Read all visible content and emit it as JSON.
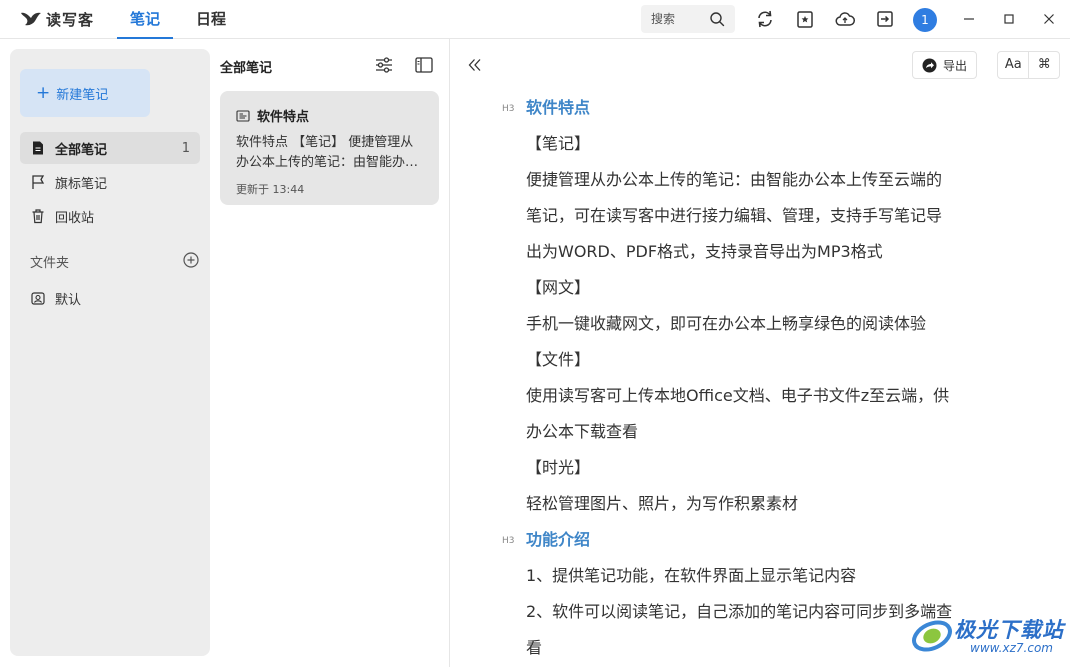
{
  "app": {
    "name": "读写客"
  },
  "top_tabs": [
    {
      "label": "笔记",
      "active": true
    },
    {
      "label": "日程",
      "active": false
    }
  ],
  "search": {
    "placeholder": "搜索"
  },
  "user": {
    "badge": "1"
  },
  "colors": {
    "accent": "#2478d8",
    "heading": "#3f86c8",
    "sidebar_bg": "#ededed",
    "new_note_bg": "#d6e4f5"
  },
  "sidebar": {
    "new_note_label": "新建笔记",
    "items": [
      {
        "label": "全部笔记",
        "count": "1",
        "icon": "note-icon",
        "active": true
      },
      {
        "label": "旗标笔记",
        "icon": "flag-icon"
      },
      {
        "label": "回收站",
        "icon": "trash-icon"
      }
    ],
    "folders_label": "文件夹",
    "folders": [
      {
        "label": "默认",
        "icon": "folder-user-icon"
      }
    ]
  },
  "note_list": {
    "title": "全部笔记",
    "notes": [
      {
        "title": "软件特点",
        "excerpt": "软件特点 【笔记】 便捷管理从办公本上传的笔记：由智能办公本上传至云端的笔记",
        "updated": "更新于 13:44"
      }
    ]
  },
  "editor": {
    "export_label": "导出",
    "font_button": "Aa",
    "shortcut_button": "⌘",
    "lines": [
      {
        "type": "h3",
        "tag": "H3",
        "text": "软件特点"
      },
      {
        "type": "p",
        "text": "【笔记】"
      },
      {
        "type": "p",
        "text": "便捷管理从办公本上传的笔记：由智能办公本上传至云端的"
      },
      {
        "type": "p",
        "text": "笔记，可在读写客中进行接力编辑、管理，支持手写笔记导"
      },
      {
        "type": "p",
        "text": "出为WORD、PDF格式，支持录音导出为MP3格式"
      },
      {
        "type": "p",
        "text": "【网文】"
      },
      {
        "type": "p",
        "text": "手机一键收藏网文，即可在办公本上畅享绿色的阅读体验"
      },
      {
        "type": "p",
        "text": "【文件】"
      },
      {
        "type": "p",
        "text": "使用读写客可上传本地Office文档、电子书文件z至云端，供"
      },
      {
        "type": "p",
        "text": "办公本下载查看"
      },
      {
        "type": "p",
        "text": "【时光】"
      },
      {
        "type": "p",
        "text": "轻松管理图片、照片，为写作积累素材"
      },
      {
        "type": "h3",
        "tag": "H3",
        "text": "功能介绍"
      },
      {
        "type": "p",
        "text": "1、提供笔记功能，在软件界面上显示笔记内容"
      },
      {
        "type": "p",
        "text": "2、软件可以阅读笔记，自己添加的笔记内容可同步到多端查"
      },
      {
        "type": "p",
        "text": "看"
      }
    ]
  },
  "watermark": {
    "text": "极光下载站",
    "url": "www.xz7.com"
  }
}
